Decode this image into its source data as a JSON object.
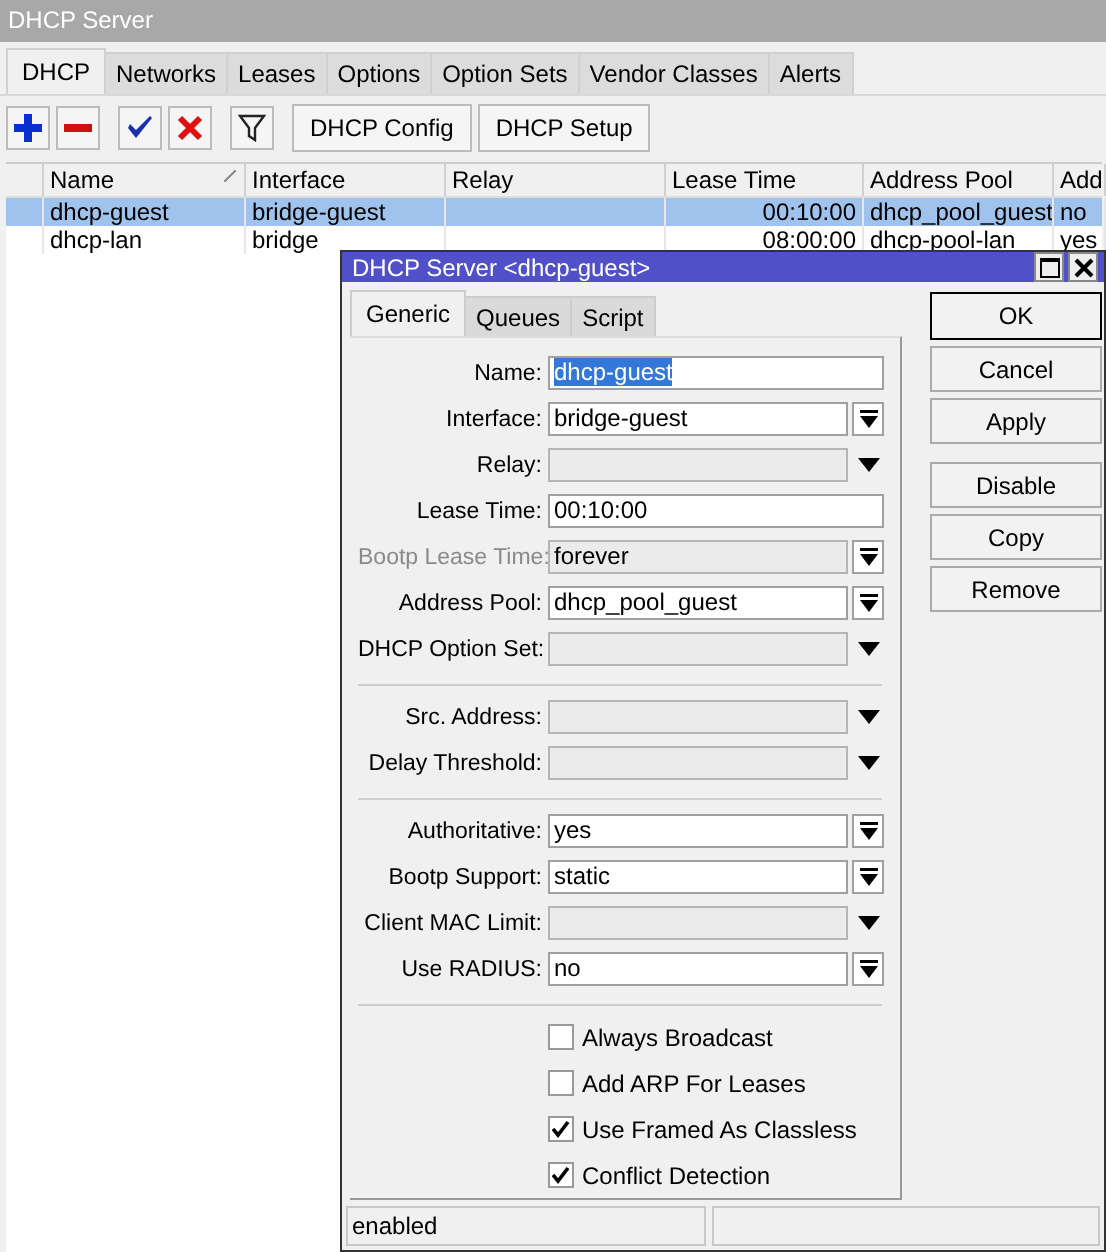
{
  "window": {
    "title": "DHCP Server"
  },
  "tabs": [
    {
      "label": "DHCP",
      "selected": true
    },
    {
      "label": "Networks",
      "selected": false
    },
    {
      "label": "Leases",
      "selected": false
    },
    {
      "label": "Options",
      "selected": false
    },
    {
      "label": "Option Sets",
      "selected": false
    },
    {
      "label": "Vendor Classes",
      "selected": false
    },
    {
      "label": "Alerts",
      "selected": false
    }
  ],
  "toolbar": {
    "icon_buttons": [
      {
        "kind": "add"
      },
      {
        "kind": "remove"
      },
      {
        "kind": "enable"
      },
      {
        "kind": "disable"
      },
      {
        "kind": "filter"
      }
    ],
    "buttons": [
      "DHCP Config",
      "DHCP Setup"
    ]
  },
  "table": {
    "columns": [
      "Name",
      "Interface",
      "Relay",
      "Lease Time",
      "Address Pool",
      "Add"
    ],
    "rows": [
      {
        "selected": true,
        "cells": [
          "dhcp-guest",
          "bridge-guest",
          "",
          "00:10:00",
          "dhcp_pool_guest",
          "no"
        ]
      },
      {
        "selected": false,
        "cells": [
          "dhcp-lan",
          "bridge",
          "",
          "08:00:00",
          "dhcp-pool-lan",
          "yes"
        ]
      }
    ]
  },
  "dialog": {
    "title": "DHCP Server <dhcp-guest>",
    "tabs": [
      {
        "label": "Generic",
        "selected": true
      },
      {
        "label": "Queues",
        "selected": false
      },
      {
        "label": "Script",
        "selected": false
      }
    ],
    "sections": [
      [
        {
          "label": "Name:",
          "value": "dhcp-guest",
          "kind": "text",
          "disabled": false,
          "text_selected": true
        },
        {
          "label": "Interface:",
          "value": "bridge-guest",
          "kind": "select",
          "disabled": false,
          "text_selected": false
        },
        {
          "label": "Relay:",
          "kind": "optional",
          "disabled": false
        },
        {
          "label": "Lease Time:",
          "value": "00:10:00",
          "kind": "text",
          "disabled": false,
          "text_selected": false
        },
        {
          "label": "Bootp Lease Time:",
          "value": "forever",
          "kind": "select",
          "disabled": true,
          "text_selected": false
        },
        {
          "label": "Address Pool:",
          "value": "dhcp_pool_guest",
          "kind": "select",
          "disabled": false,
          "text_selected": false
        },
        {
          "label": "DHCP Option Set:",
          "kind": "optional",
          "disabled": false
        }
      ],
      [
        {
          "label": "Src. Address:",
          "kind": "optional",
          "disabled": false
        },
        {
          "label": "Delay Threshold:",
          "kind": "optional",
          "disabled": false
        }
      ],
      [
        {
          "label": "Authoritative:",
          "value": "yes",
          "kind": "select",
          "disabled": false,
          "text_selected": false
        },
        {
          "label": "Bootp Support:",
          "value": "static",
          "kind": "select",
          "disabled": false,
          "text_selected": false
        },
        {
          "label": "Client MAC Limit:",
          "kind": "optional",
          "disabled": false
        },
        {
          "label": "Use RADIUS:",
          "value": "no",
          "kind": "select",
          "disabled": false,
          "text_selected": false
        }
      ]
    ],
    "checkboxes": [
      {
        "label": "Always Broadcast",
        "checked": false
      },
      {
        "label": "Add ARP For Leases",
        "checked": false
      },
      {
        "label": "Use Framed As Classless",
        "checked": true
      },
      {
        "label": "Conflict Detection",
        "checked": true
      }
    ],
    "buttons": [
      {
        "label": "OK",
        "kind": "default"
      },
      {
        "label": "Cancel",
        "kind": "normal"
      },
      {
        "label": "Apply",
        "kind": "normal"
      },
      {
        "label": "Disable",
        "kind": "spaced"
      },
      {
        "label": "Copy",
        "kind": "normal"
      },
      {
        "label": "Remove",
        "kind": "normal"
      }
    ],
    "status_bar": [
      "enabled"
    ]
  }
}
